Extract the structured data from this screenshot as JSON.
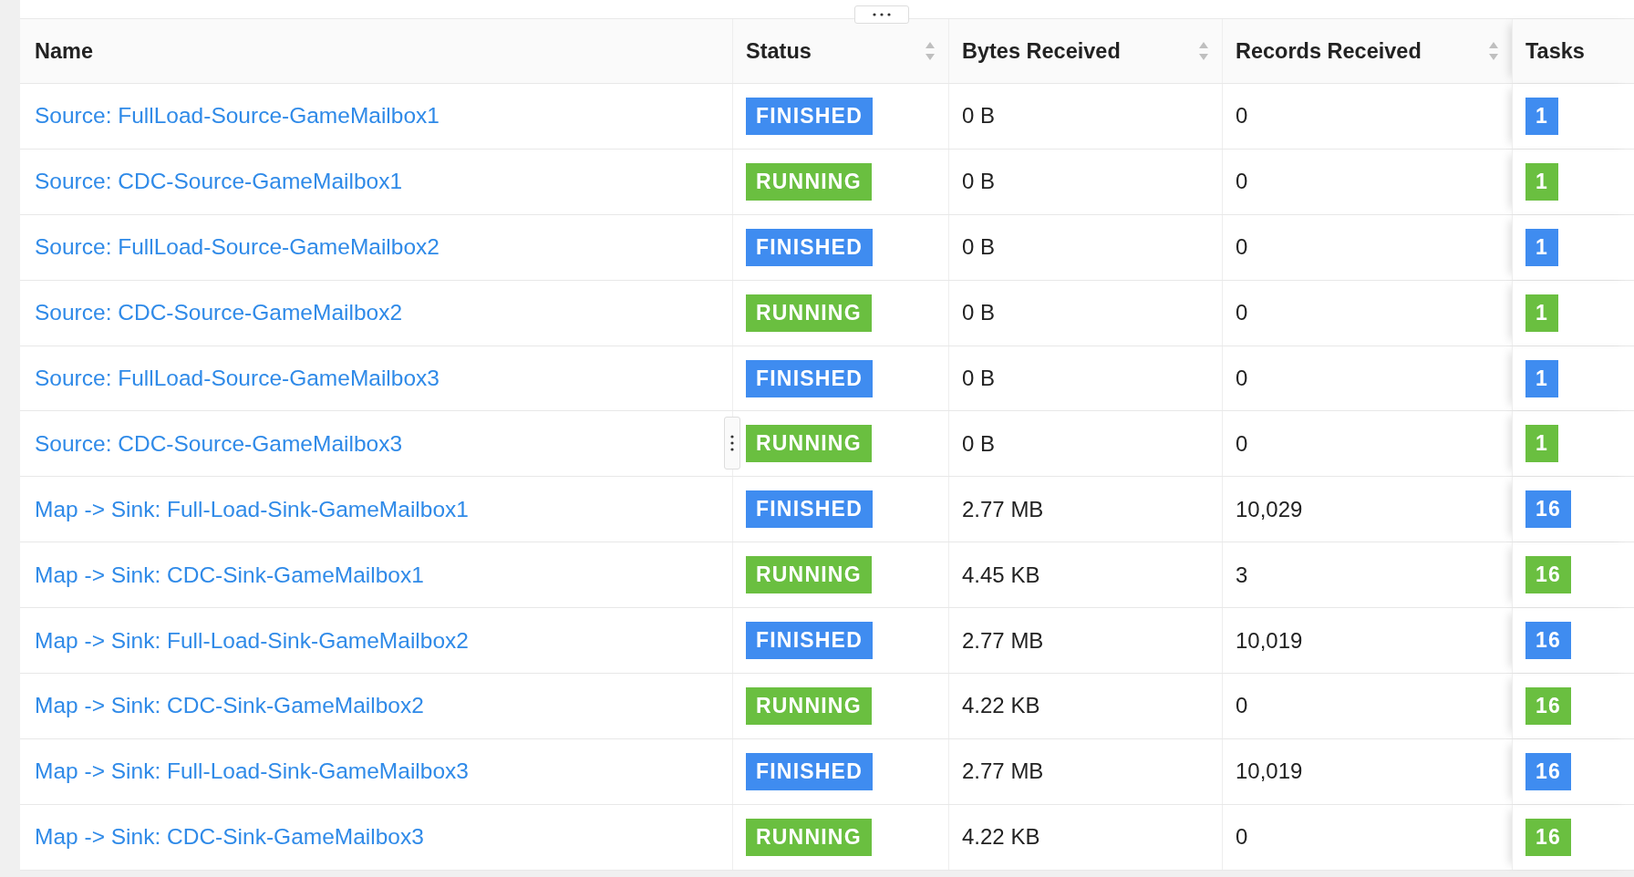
{
  "columns": [
    {
      "label": "Name",
      "sortable": false
    },
    {
      "label": "Status",
      "sortable": true
    },
    {
      "label": "Bytes Received",
      "sortable": true
    },
    {
      "label": "Records Received",
      "sortable": true
    },
    {
      "label": "Tasks",
      "sortable": false
    }
  ],
  "rows": [
    {
      "name": "Source: FullLoad-Source-GameMailbox1",
      "status": "FINISHED",
      "kind": "finished",
      "bytes": "0 B",
      "records": "0",
      "tasks": "1"
    },
    {
      "name": "Source: CDC-Source-GameMailbox1",
      "status": "RUNNING",
      "kind": "running",
      "bytes": "0 B",
      "records": "0",
      "tasks": "1"
    },
    {
      "name": "Source: FullLoad-Source-GameMailbox2",
      "status": "FINISHED",
      "kind": "finished",
      "bytes": "0 B",
      "records": "0",
      "tasks": "1"
    },
    {
      "name": "Source: CDC-Source-GameMailbox2",
      "status": "RUNNING",
      "kind": "running",
      "bytes": "0 B",
      "records": "0",
      "tasks": "1"
    },
    {
      "name": "Source: FullLoad-Source-GameMailbox3",
      "status": "FINISHED",
      "kind": "finished",
      "bytes": "0 B",
      "records": "0",
      "tasks": "1"
    },
    {
      "name": "Source: CDC-Source-GameMailbox3",
      "status": "RUNNING",
      "kind": "running",
      "bytes": "0 B",
      "records": "0",
      "tasks": "1"
    },
    {
      "name": "Map -> Sink: Full-Load-Sink-GameMailbox1",
      "status": "FINISHED",
      "kind": "finished",
      "bytes": "2.77 MB",
      "records": "10,029",
      "tasks": "16"
    },
    {
      "name": "Map -> Sink: CDC-Sink-GameMailbox1",
      "status": "RUNNING",
      "kind": "running",
      "bytes": "4.45 KB",
      "records": "3",
      "tasks": "16"
    },
    {
      "name": "Map -> Sink: Full-Load-Sink-GameMailbox2",
      "status": "FINISHED",
      "kind": "finished",
      "bytes": "2.77 MB",
      "records": "10,019",
      "tasks": "16"
    },
    {
      "name": "Map -> Sink: CDC-Sink-GameMailbox2",
      "status": "RUNNING",
      "kind": "running",
      "bytes": "4.22 KB",
      "records": "0",
      "tasks": "16"
    },
    {
      "name": "Map -> Sink: Full-Load-Sink-GameMailbox3",
      "status": "FINISHED",
      "kind": "finished",
      "bytes": "2.77 MB",
      "records": "10,019",
      "tasks": "16"
    },
    {
      "name": "Map -> Sink: CDC-Sink-GameMailbox3",
      "status": "RUNNING",
      "kind": "running",
      "bytes": "4.22 KB",
      "records": "0",
      "tasks": "16"
    }
  ]
}
